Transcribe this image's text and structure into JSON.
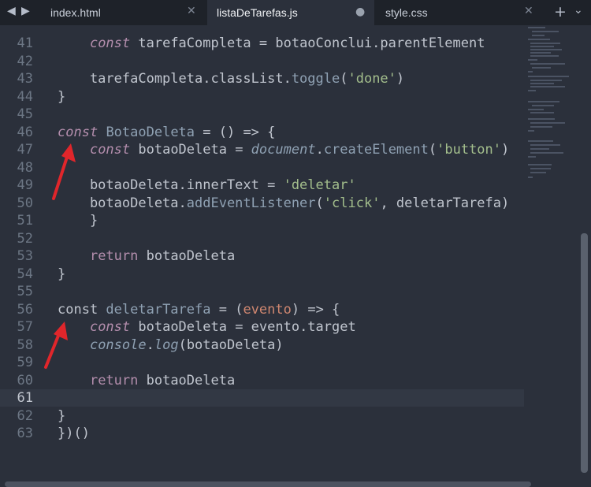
{
  "tabs": [
    {
      "label": "index.html",
      "close": "✕"
    },
    {
      "label": "listaDeTarefas.js",
      "close": "●"
    },
    {
      "label": "style.css",
      "close": "✕"
    }
  ],
  "nav": {
    "back": "◀",
    "forward": "▶",
    "add": "+",
    "more": "⌄"
  },
  "lines": [
    {
      "num": "41",
      "tokens": [
        {
          "t": "    "
        },
        {
          "t": "const",
          "c": "kw"
        },
        {
          "t": " tarefaCompleta = botaoConclui.parentElement"
        }
      ]
    },
    {
      "num": "42",
      "tokens": []
    },
    {
      "num": "43",
      "tokens": [
        {
          "t": "    tarefaCompleta.classList."
        },
        {
          "t": "toggle",
          "c": "fn"
        },
        {
          "t": "("
        },
        {
          "t": "'done'",
          "c": "str"
        },
        {
          "t": ")"
        }
      ]
    },
    {
      "num": "44",
      "tokens": [
        {
          "t": "}"
        }
      ]
    },
    {
      "num": "45",
      "tokens": []
    },
    {
      "num": "46",
      "tokens": [
        {
          "t": "const",
          "c": "kw"
        },
        {
          "t": " "
        },
        {
          "t": "BotaoDeleta",
          "c": "fn"
        },
        {
          "t": " = () => {"
        }
      ]
    },
    {
      "num": "47",
      "tokens": [
        {
          "t": "    "
        },
        {
          "t": "const",
          "c": "kw"
        },
        {
          "t": " botaoDeleta = "
        },
        {
          "t": "document",
          "c": "fni"
        },
        {
          "t": "."
        },
        {
          "t": "createElement",
          "c": "fn"
        },
        {
          "t": "("
        },
        {
          "t": "'button'",
          "c": "str"
        },
        {
          "t": ")"
        }
      ]
    },
    {
      "num": "48",
      "tokens": []
    },
    {
      "num": "49",
      "tokens": [
        {
          "t": "    botaoDeleta.innerText = "
        },
        {
          "t": "'deletar'",
          "c": "str"
        }
      ]
    },
    {
      "num": "50",
      "tokens": [
        {
          "t": "    botaoDeleta."
        },
        {
          "t": "addEventListener",
          "c": "fn"
        },
        {
          "t": "("
        },
        {
          "t": "'click'",
          "c": "str"
        },
        {
          "t": ", deletarTarefa)"
        }
      ]
    },
    {
      "num": "51",
      "tokens": [
        {
          "t": "    }"
        }
      ]
    },
    {
      "num": "52",
      "tokens": []
    },
    {
      "num": "53",
      "tokens": [
        {
          "t": "    "
        },
        {
          "t": "return",
          "c": "kw2"
        },
        {
          "t": " botaoDeleta"
        }
      ]
    },
    {
      "num": "54",
      "tokens": [
        {
          "t": "}"
        }
      ]
    },
    {
      "num": "55",
      "tokens": []
    },
    {
      "num": "56",
      "tokens": [
        {
          "t": "const deletarTarefa",
          "c": "mix1"
        },
        {
          "t": " = ("
        },
        {
          "t": "evento",
          "c": "prm"
        },
        {
          "t": ") => {"
        }
      ]
    },
    {
      "num": "57",
      "tokens": [
        {
          "t": "    "
        },
        {
          "t": "const",
          "c": "kw"
        },
        {
          "t": " botaoDeleta = evento.target"
        }
      ]
    },
    {
      "num": "58",
      "tokens": [
        {
          "t": "    "
        },
        {
          "t": "console",
          "c": "fni"
        },
        {
          "t": "."
        },
        {
          "t": "log",
          "c": "fni"
        },
        {
          "t": "(botaoDeleta)"
        }
      ]
    },
    {
      "num": "59",
      "tokens": []
    },
    {
      "num": "60",
      "tokens": [
        {
          "t": "    "
        },
        {
          "t": "return",
          "c": "kw2"
        },
        {
          "t": " botaoDeleta"
        }
      ]
    },
    {
      "num": "61",
      "tokens": [],
      "current": true
    },
    {
      "num": "62",
      "tokens": [
        {
          "t": "}"
        }
      ]
    },
    {
      "num": "63",
      "tokens": [
        {
          "t": "})()"
        }
      ]
    }
  ],
  "colors": {
    "background": "#2b303b",
    "keyword": "#b48ead",
    "function": "#8fa1b3",
    "string": "#a3be8c",
    "parameter": "#d08770",
    "annotation_arrow": "#e0262b"
  }
}
